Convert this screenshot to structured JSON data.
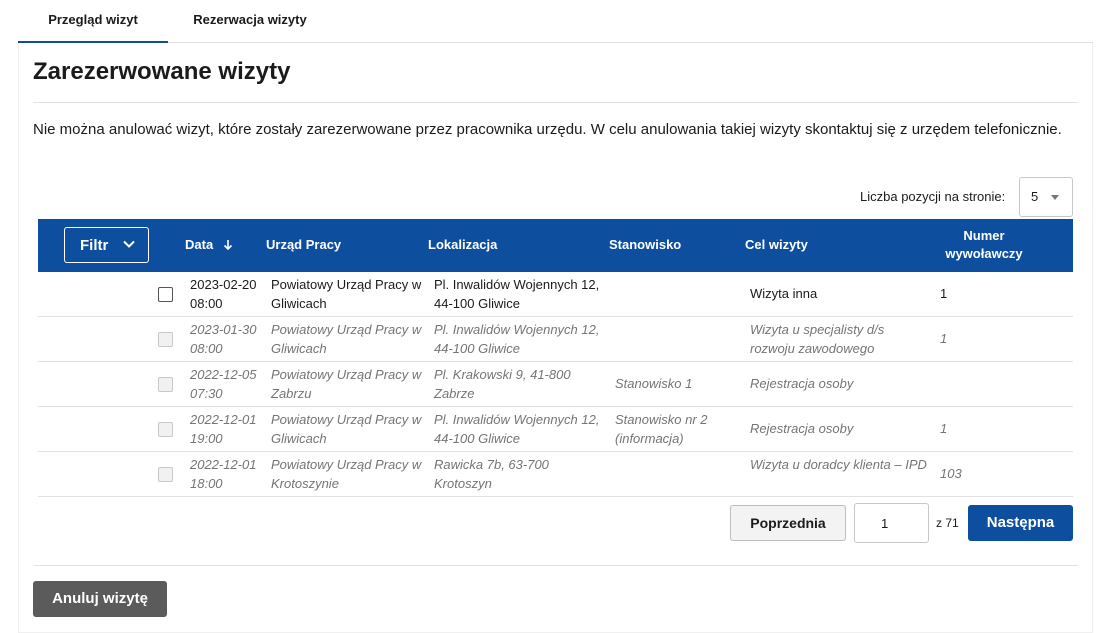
{
  "tabs": [
    {
      "label": "Przegląd wizyt",
      "active": true
    },
    {
      "label": "Rezerwacja wizyty",
      "active": false
    }
  ],
  "page_title": "Zarezerwowane wizyty",
  "info_text": "Nie można anulować wizyt, które zostały zarezerwowane przez pracownika urzędu. W celu anulowania takiej wizyty skontaktuj się z urzędem telefonicznie.",
  "per_page": {
    "label": "Liczba pozycji na stronie:",
    "value": "5"
  },
  "filter": {
    "label": "Filtr",
    "icon": "chevron-down-icon"
  },
  "columns": {
    "date": "Data",
    "office": "Urząd Pracy",
    "location": "Lokalizacja",
    "station": "Stanowisko",
    "purpose": "Cel wizyty",
    "number": "Numer wywoławczy"
  },
  "rows": [
    {
      "date": "2023-02-20",
      "time": "08:00",
      "office": "Powiatowy Urząd Pracy w Gliwicach",
      "location": "Pl. Inwalidów Wojennych 12, 44-100 Gliwice",
      "station": "",
      "purpose": "Wizyta inna",
      "number": "1",
      "enabled": true
    },
    {
      "date": "2023-01-30",
      "time": "08:00",
      "office": "Powiatowy Urząd Pracy w Gliwicach",
      "location": "Pl. Inwalidów Wojennych 12, 44-100 Gliwice",
      "station": "",
      "purpose": "Wizyta u specjalisty d/s rozwoju zawodowego",
      "number": "1",
      "enabled": false
    },
    {
      "date": "2022-12-05",
      "time": "07:30",
      "office": "Powiatowy Urząd Pracy w Zabrzu",
      "location": "Pl. Krakowski 9, 41-800 Zabrze",
      "station": "Stanowisko 1",
      "purpose": "Rejestracja osoby",
      "number": "",
      "enabled": false
    },
    {
      "date": "2022-12-01",
      "time": "19:00",
      "office": "Powiatowy Urząd Pracy w Gliwicach",
      "location": "Pl. Inwalidów Wojennych 12, 44-100 Gliwice",
      "station": "Stanowisko nr 2 (informacja)",
      "purpose": "Rejestracja osoby",
      "number": "1",
      "enabled": false
    },
    {
      "date": "2022-12-01",
      "time": "18:00",
      "office": "Powiatowy Urząd Pracy w Krotoszynie",
      "location": "Rawicka 7b, 63-700 Krotoszyn",
      "station": "",
      "purpose": "Wizyta u doradcy klienta – IPD",
      "number": "103",
      "enabled": false
    }
  ],
  "pagination": {
    "prev_label": "Poprzednia",
    "current_page": "1",
    "of_label": "z 71",
    "next_label": "Następna"
  },
  "cancel_label": "Anuluj wizytę",
  "colors": {
    "primary": "#0d4f9e",
    "cancel": "#5b5b5b"
  }
}
